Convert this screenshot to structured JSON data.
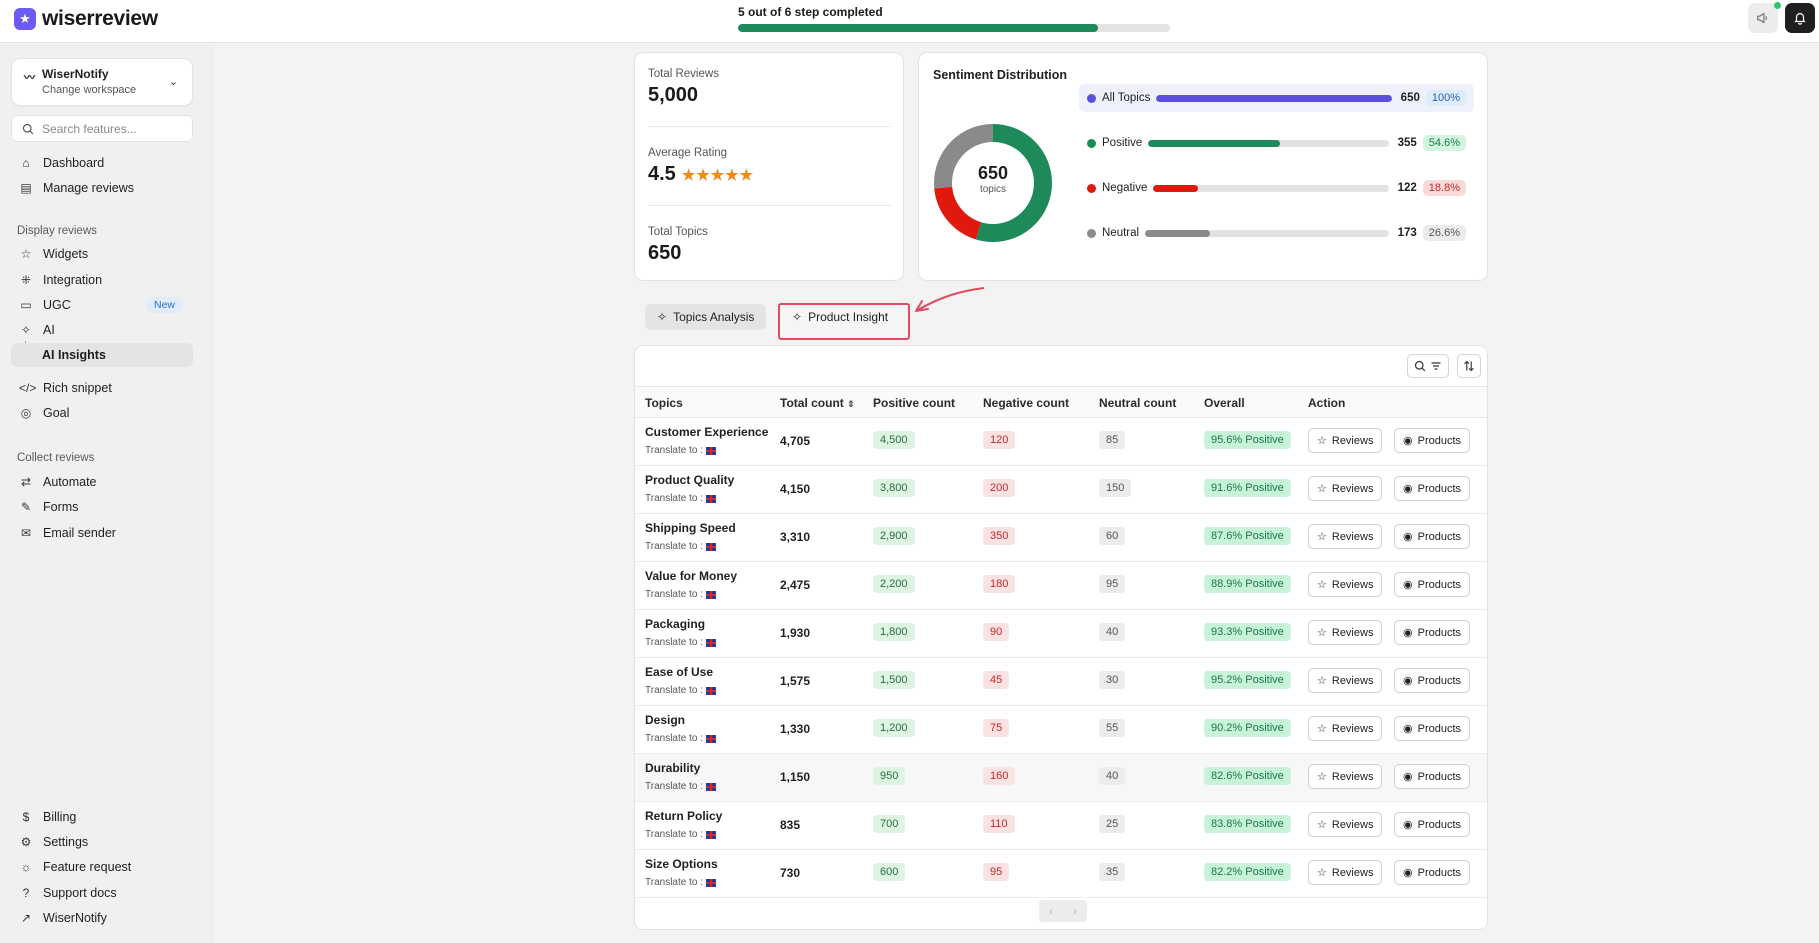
{
  "brand": {
    "name": "wiserreview"
  },
  "progress": {
    "label": "5 out of 6 step completed",
    "fraction": 0.8333
  },
  "workspace": {
    "name": "WiserNotify",
    "sub": "Change workspace"
  },
  "search": {
    "placeholder": "Search features..."
  },
  "sidebar": {
    "top_items": [
      {
        "label": "Dashboard",
        "icon": "home-icon"
      },
      {
        "label": "Manage reviews",
        "icon": "document-icon"
      }
    ],
    "display_label": "Display reviews",
    "display_items": [
      {
        "label": "Widgets",
        "icon": "star-icon"
      },
      {
        "label": "Integration",
        "icon": "integration-icon"
      },
      {
        "label": "UGC",
        "icon": "chat-icon",
        "badge": "New"
      },
      {
        "label": "AI",
        "icon": "sparkle-icon"
      },
      {
        "label": "AI Insights",
        "icon": ""
      },
      {
        "label": "Rich snippet",
        "icon": "code-icon"
      },
      {
        "label": "Goal",
        "icon": "target-icon"
      }
    ],
    "collect_label": "Collect reviews",
    "collect_items": [
      {
        "label": "Automate",
        "icon": "refresh-icon"
      },
      {
        "label": "Forms",
        "icon": "edit-icon"
      },
      {
        "label": "Email sender",
        "icon": "mail-icon"
      }
    ],
    "bottom_items": [
      {
        "label": "Billing",
        "icon": "billing-icon"
      },
      {
        "label": "Settings",
        "icon": "gear-icon"
      },
      {
        "label": "Feature request",
        "icon": "bulb-icon"
      },
      {
        "label": "Support docs",
        "icon": "help-icon"
      },
      {
        "label": "WiserNotify",
        "icon": "external-link-icon"
      }
    ]
  },
  "stats": {
    "total_reviews_label": "Total Reviews",
    "total_reviews": "5,000",
    "avg_rating_label": "Average Rating",
    "avg_rating": "4.5",
    "stars": "★★★★★",
    "total_topics_label": "Total Topics",
    "total_topics": "650"
  },
  "sentiment": {
    "title": "Sentiment Distribution",
    "donut_value": "650",
    "donut_sub": "topics",
    "rows": [
      {
        "name": "All Topics",
        "count": "650",
        "pct": "100%",
        "fraction": 1.0,
        "color": "#5b4fe0",
        "pct_bg": "#dcecfb",
        "pct_color": "#2b62b0"
      },
      {
        "name": "Positive",
        "count": "355",
        "pct": "54.6%",
        "fraction": 0.546,
        "color": "#1e8a5a",
        "pct_bg": "#d2f5df",
        "pct_color": "#1a7a45"
      },
      {
        "name": "Negative",
        "count": "122",
        "pct": "18.8%",
        "fraction": 0.188,
        "color": "#e0190f",
        "pct_bg": "#fbd9d9",
        "pct_color": "#c62828"
      },
      {
        "name": "Neutral",
        "count": "173",
        "pct": "26.6%",
        "fraction": 0.266,
        "color": "#8a8a8a",
        "pct_bg": "#ececec",
        "pct_color": "#555555"
      }
    ]
  },
  "tabs": {
    "topics": "Topics Analysis",
    "product": "Product Insight"
  },
  "table": {
    "headers": [
      "Topics",
      "Total count",
      "Positive count",
      "Negative count",
      "Neutral count",
      "Overall",
      "Action"
    ],
    "translate_label": "Translate to :",
    "reviews_label": "Reviews",
    "products_label": "Products",
    "rows": [
      {
        "topic": "Customer Experience",
        "total": "4,705",
        "pos": "4,500",
        "neg": "120",
        "neu": "85",
        "overall": "95.6% Positive"
      },
      {
        "topic": "Product Quality",
        "total": "4,150",
        "pos": "3,800",
        "neg": "200",
        "neu": "150",
        "overall": "91.6% Positive"
      },
      {
        "topic": "Shipping Speed",
        "total": "3,310",
        "pos": "2,900",
        "neg": "350",
        "neu": "60",
        "overall": "87.6% Positive"
      },
      {
        "topic": "Value for Money",
        "total": "2,475",
        "pos": "2,200",
        "neg": "180",
        "neu": "95",
        "overall": "88.9% Positive"
      },
      {
        "topic": "Packaging",
        "total": "1,930",
        "pos": "1,800",
        "neg": "90",
        "neu": "40",
        "overall": "93.3% Positive"
      },
      {
        "topic": "Ease of Use",
        "total": "1,575",
        "pos": "1,500",
        "neg": "45",
        "neu": "30",
        "overall": "95.2% Positive"
      },
      {
        "topic": "Design",
        "total": "1,330",
        "pos": "1,200",
        "neg": "75",
        "neu": "55",
        "overall": "90.2% Positive"
      },
      {
        "topic": "Durability",
        "total": "1,150",
        "pos": "950",
        "neg": "160",
        "neu": "40",
        "overall": "82.6% Positive"
      },
      {
        "topic": "Return Policy",
        "total": "835",
        "pos": "700",
        "neg": "110",
        "neu": "25",
        "overall": "83.8% Positive"
      },
      {
        "topic": "Size Options",
        "total": "730",
        "pos": "600",
        "neg": "95",
        "neu": "35",
        "overall": "82.2% Positive"
      }
    ]
  }
}
